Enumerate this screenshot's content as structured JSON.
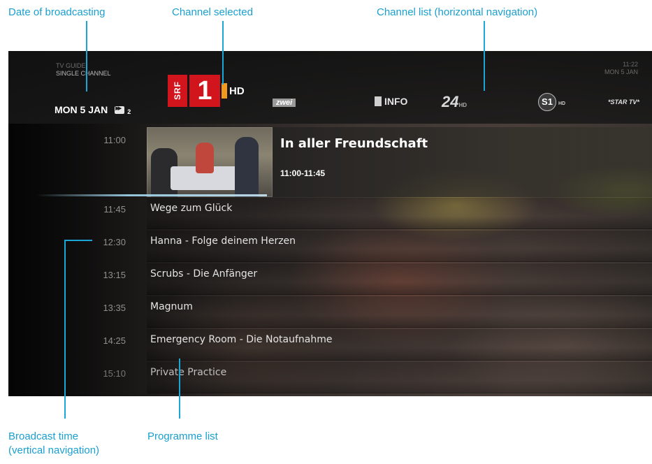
{
  "annotations": {
    "date": "Date of broadcasting",
    "channel_selected": "Channel selected",
    "channel_list": "Channel list (horizontal navigation)",
    "broadcast_time_line1": "Broadcast time",
    "broadcast_time_line2": "(vertical navigation)",
    "programme_list": "Programme list"
  },
  "colors": {
    "annotation": "#1a9fd0",
    "srf_red": "#d2141c",
    "hd_orange": "#f29a1e"
  },
  "header": {
    "guide_title_line1": "TV GUIDE",
    "guide_title_line2": "SINGLE CHANNEL",
    "date": "MON 5 JAN",
    "day_count": "2",
    "clock_line1": "11:22",
    "clock_line2": "MON 5 JAN"
  },
  "selected_channel": {
    "brand": "SRF",
    "number": "1",
    "hd": "HD"
  },
  "channels": [
    {
      "label": "zwei",
      "icon": "srf-zwei-logo"
    },
    {
      "label": "INFO",
      "icon": "srf-info-logo"
    },
    {
      "label": "24",
      "sub": "HD",
      "icon": "tv24-logo"
    },
    {
      "label": "S1",
      "sub": "HD",
      "icon": "s1-logo"
    },
    {
      "label": "*STAR TV*",
      "icon": "star-tv-logo"
    }
  ],
  "current_programme": {
    "time": "11:00",
    "title": "In aller Freundschaft",
    "timespan": "11:00-11:45"
  },
  "programmes": [
    {
      "time": "11:45",
      "title": "Wege zum Glück"
    },
    {
      "time": "12:30",
      "title": "Hanna - Folge deinem Herzen"
    },
    {
      "time": "13:15",
      "title": "Scrubs - Die Anfänger"
    },
    {
      "time": "13:35",
      "title": "Magnum"
    },
    {
      "time": "14:25",
      "title": "Emergency Room - Die Notaufnahme"
    },
    {
      "time": "15:10",
      "title": "Private Practice"
    }
  ]
}
